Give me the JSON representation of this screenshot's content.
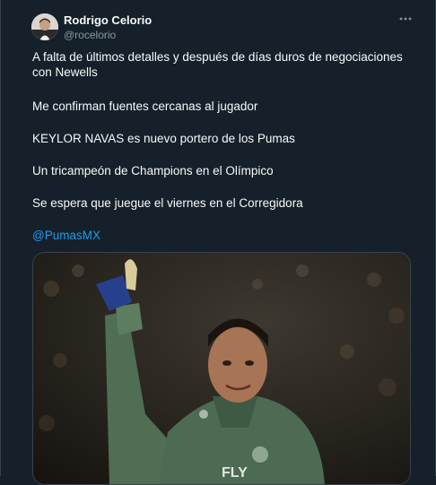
{
  "author": {
    "name": "Rodrigo Celorio",
    "handle": "@rocelorio"
  },
  "tweet": {
    "paragraph1": "A falta de últimos detalles y después de días duros de negociaciones con Newells",
    "paragraph2": "Me confirman fuentes cercanas al jugador",
    "paragraph3": "KEYLOR NAVAS es nuevo portero de los Pumas",
    "paragraph4": "Un tricampeón de Champions en el Olímpico",
    "paragraph5": "Se espera que juegue el viernes en el Corregidora",
    "mention": "@PumasMX"
  },
  "media": {
    "shirt_text": "FLY"
  },
  "icons": {
    "more": "more-dots-icon"
  },
  "colors": {
    "background": "#15202b",
    "text": "#f7f9f9",
    "secondary": "#8b98a5",
    "link": "#1d9bf0",
    "border": "#38444d"
  }
}
